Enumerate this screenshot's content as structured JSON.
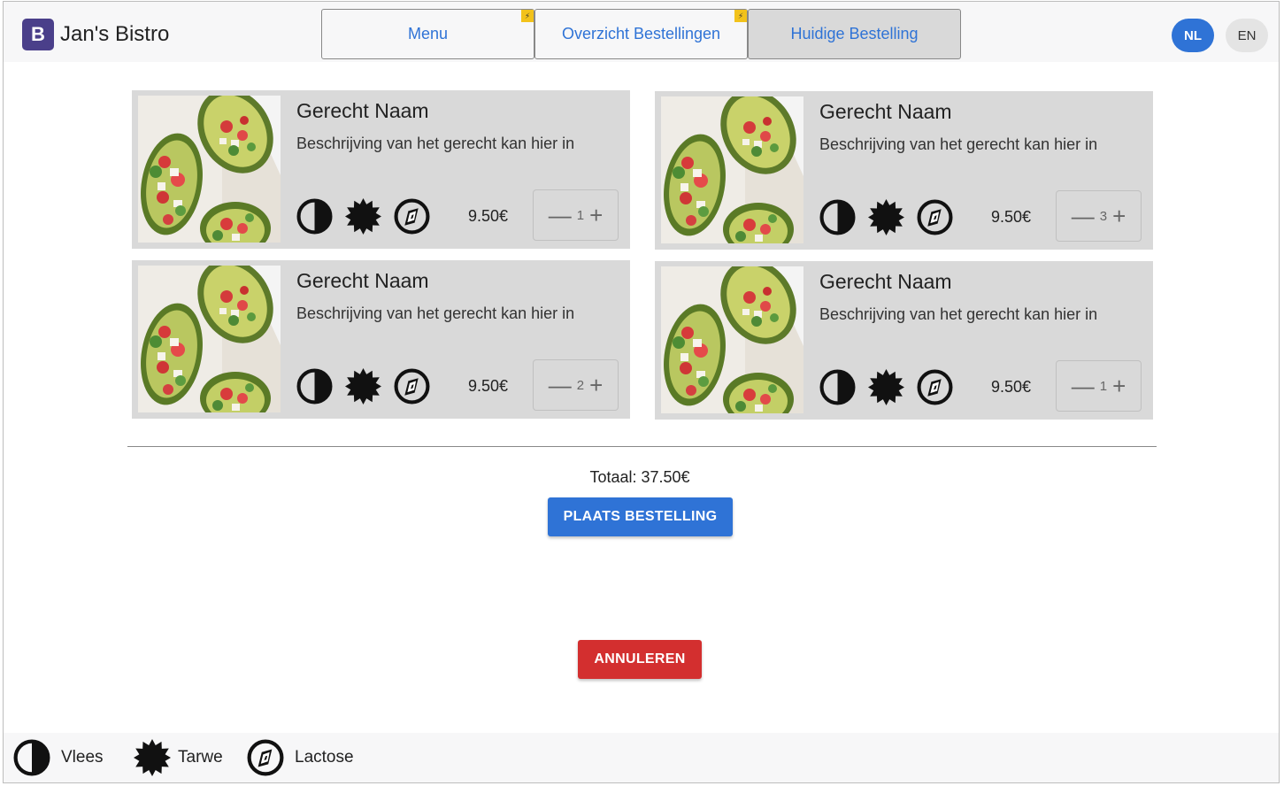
{
  "header": {
    "logo_letter": "B",
    "brand": "Jan's Bistro",
    "tabs": [
      {
        "label": "Menu"
      },
      {
        "label": "Overzicht Bestellingen"
      },
      {
        "label": "Huidige Bestelling"
      }
    ],
    "languages": {
      "nl": "NL",
      "en": "EN"
    }
  },
  "dishes": [
    {
      "name": "Gerecht Naam",
      "description": "Beschrijving van het gerecht kan hier in",
      "price": "9.50€",
      "quantity": "1"
    },
    {
      "name": "Gerecht Naam",
      "description": "Beschrijving van het gerecht kan hier in",
      "price": "9.50€",
      "quantity": "3"
    },
    {
      "name": "Gerecht Naam",
      "description": "Beschrijving van het gerecht kan hier in",
      "price": "9.50€",
      "quantity": "2"
    },
    {
      "name": "Gerecht Naam",
      "description": "Beschrijving van het gerecht kan hier in",
      "price": "9.50€",
      "quantity": "1"
    }
  ],
  "stepper": {
    "minus": "—",
    "plus": "+"
  },
  "total": "Totaal: 37.50€",
  "order_button": "PLAATS BESTELLING",
  "cancel_button": "ANNULEREN",
  "legend": [
    {
      "icon": "meat-icon",
      "label": "Vlees"
    },
    {
      "icon": "wheat-icon",
      "label": "Tarwe"
    },
    {
      "icon": "lactose-icon",
      "label": "Lactose"
    }
  ],
  "colors": {
    "accent": "#2f73d6",
    "danger": "#d32f2f",
    "logo": "#4a3f8a",
    "card": "#d9d9d9"
  }
}
